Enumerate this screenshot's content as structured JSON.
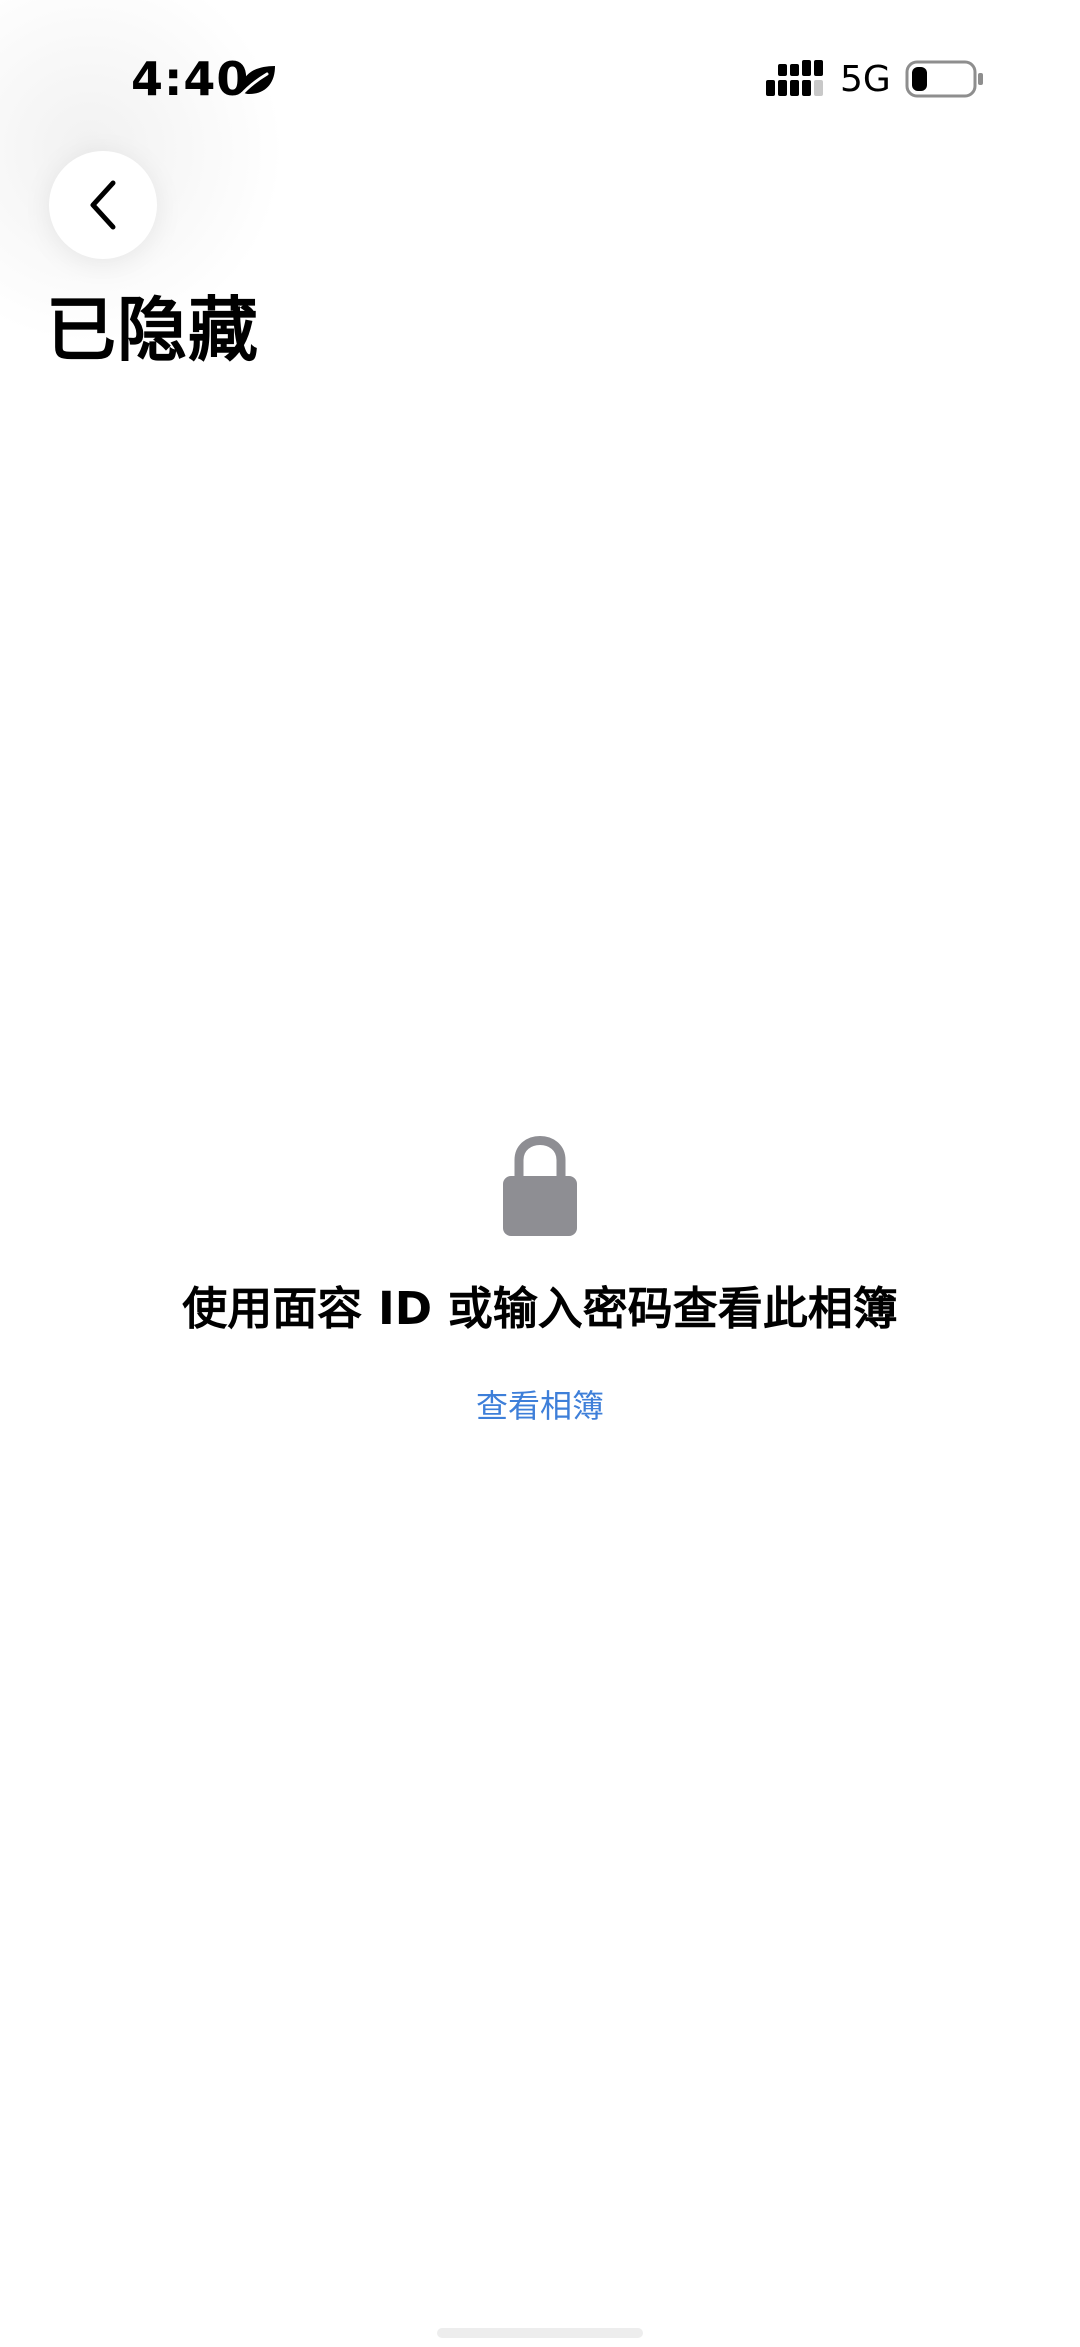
{
  "status_bar": {
    "time": "4:40",
    "leaf_icon": "leaf-icon",
    "signal_icon": "signal-bars-icon",
    "network": "5G",
    "battery_icon": "battery-icon",
    "battery_level": 0.25
  },
  "navigation": {
    "back_icon": "chevron-left-icon"
  },
  "page": {
    "title": "已隐藏"
  },
  "locked_state": {
    "lock_icon": "lock-icon",
    "message": "使用面容 ID 或输入密码查看此相簿",
    "action_label": "查看相簿",
    "action_color": "#3e7fd9"
  }
}
